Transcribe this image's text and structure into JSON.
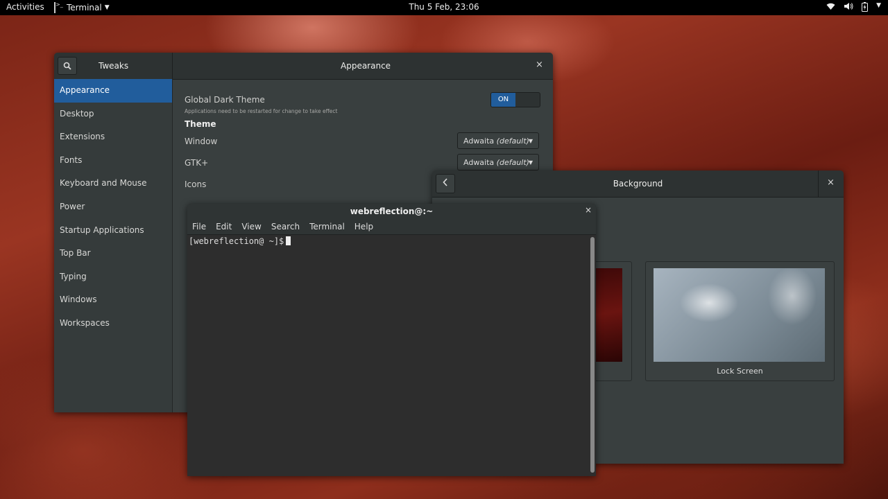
{
  "topbar": {
    "activities": "Activities",
    "app_name": "Terminal",
    "clock": "Thu  5 Feb, 23:06",
    "tray_icons": [
      "wifi-icon",
      "volume-icon",
      "battery-icon",
      "chevron-down-icon"
    ]
  },
  "tweaks": {
    "sidebar_title": "Tweaks",
    "panel_title": "Appearance",
    "close": "×",
    "sidebar_items": [
      {
        "label": "Appearance",
        "selected": true
      },
      {
        "label": "Desktop"
      },
      {
        "label": "Extensions"
      },
      {
        "label": "Fonts"
      },
      {
        "label": "Keyboard and Mouse"
      },
      {
        "label": "Power"
      },
      {
        "label": "Startup Applications"
      },
      {
        "label": "Top Bar"
      },
      {
        "label": "Typing"
      },
      {
        "label": "Windows"
      },
      {
        "label": "Workspaces"
      }
    ],
    "global_dark_theme": {
      "label": "Global Dark Theme",
      "note": "Applications need to be restarted for change to take effect",
      "switch_state": "ON"
    },
    "theme_heading": "Theme",
    "rows": [
      {
        "label": "Window",
        "value": "Adwaita",
        "suffix": "(default)"
      },
      {
        "label": "GTK+",
        "value": "Adwaita",
        "suffix": "(default)"
      },
      {
        "label": "Icons"
      }
    ]
  },
  "background_window": {
    "title": "Background",
    "close": "×",
    "cards": [
      {
        "caption": ""
      },
      {
        "caption": "Lock Screen"
      }
    ]
  },
  "terminal": {
    "title": "webreflection@:~",
    "close": "×",
    "menu": [
      "File",
      "Edit",
      "View",
      "Search",
      "Terminal",
      "Help"
    ],
    "prompt": "[webreflection@ ~]$"
  }
}
